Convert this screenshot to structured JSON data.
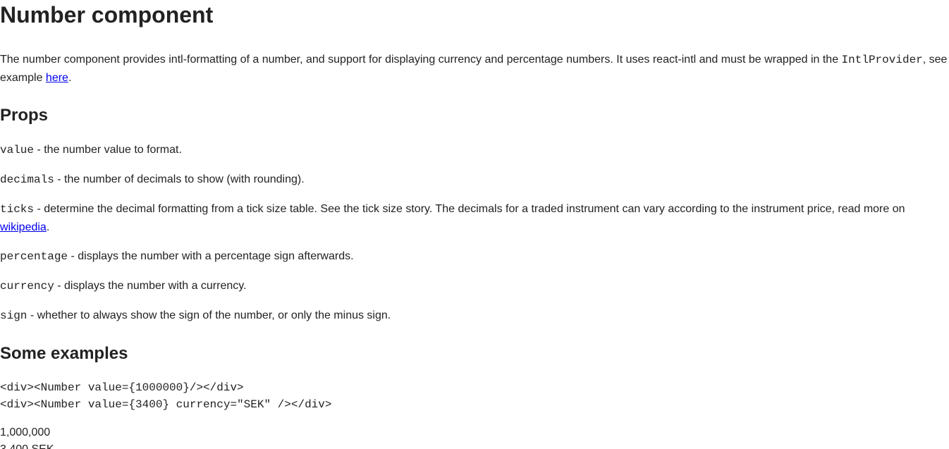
{
  "title": "Number component",
  "intro": {
    "text_before": "The number component provides intl-formatting of a number, and support for displaying currency and percentage numbers. It uses react-intl and must be wrapped in the ",
    "code": "IntlProvider",
    "text_middle": ", see example ",
    "link": "here",
    "text_after": "."
  },
  "props_heading": "Props",
  "props": [
    {
      "name": "value",
      "desc": " - the number value to format."
    },
    {
      "name": "decimals",
      "desc": " - the number of decimals to show (with rounding)."
    },
    {
      "name": "ticks",
      "desc": " - determine the decimal formatting from a tick size table. See the tick size story. The decimals for a traded instrument can vary according to the instrument price, read more on ",
      "link": "wikipedia",
      "after": "."
    },
    {
      "name": "percentage",
      "desc": " - displays the number with a percentage sign afterwards."
    },
    {
      "name": "currency",
      "desc": " - displays the number with a currency."
    },
    {
      "name": "sign",
      "desc": " - whether to always show the sign of the number, or only the minus sign."
    }
  ],
  "examples_heading": "Some examples",
  "code_lines": [
    "<div><Number value={1000000}/></div>",
    "<div><Number value={3400} currency=\"SEK\" /></div>"
  ],
  "outputs": [
    "1,000,000",
    "3,400 SEK"
  ]
}
